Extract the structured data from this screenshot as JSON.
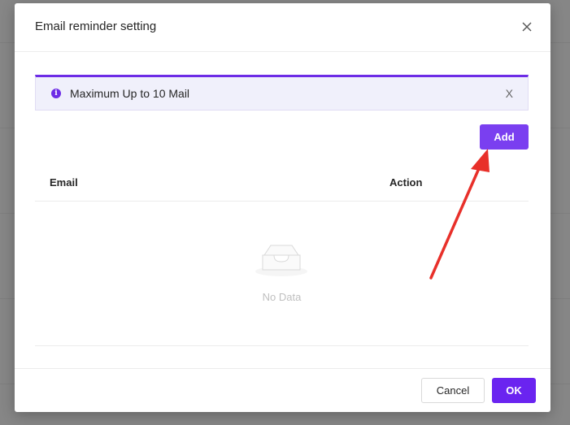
{
  "modal": {
    "title": "Email reminder setting"
  },
  "alert": {
    "icon": "info-icon",
    "text": "Maximum Up to 10 Mail",
    "close": "X"
  },
  "toolbar": {
    "add_label": "Add"
  },
  "table": {
    "columns": [
      "Email",
      "Action"
    ],
    "empty_text": "No Data"
  },
  "footer": {
    "cancel_label": "Cancel",
    "ok_label": "OK"
  },
  "colors": {
    "primary": "#6a24f0",
    "annotation_arrow": "#e8302a"
  }
}
